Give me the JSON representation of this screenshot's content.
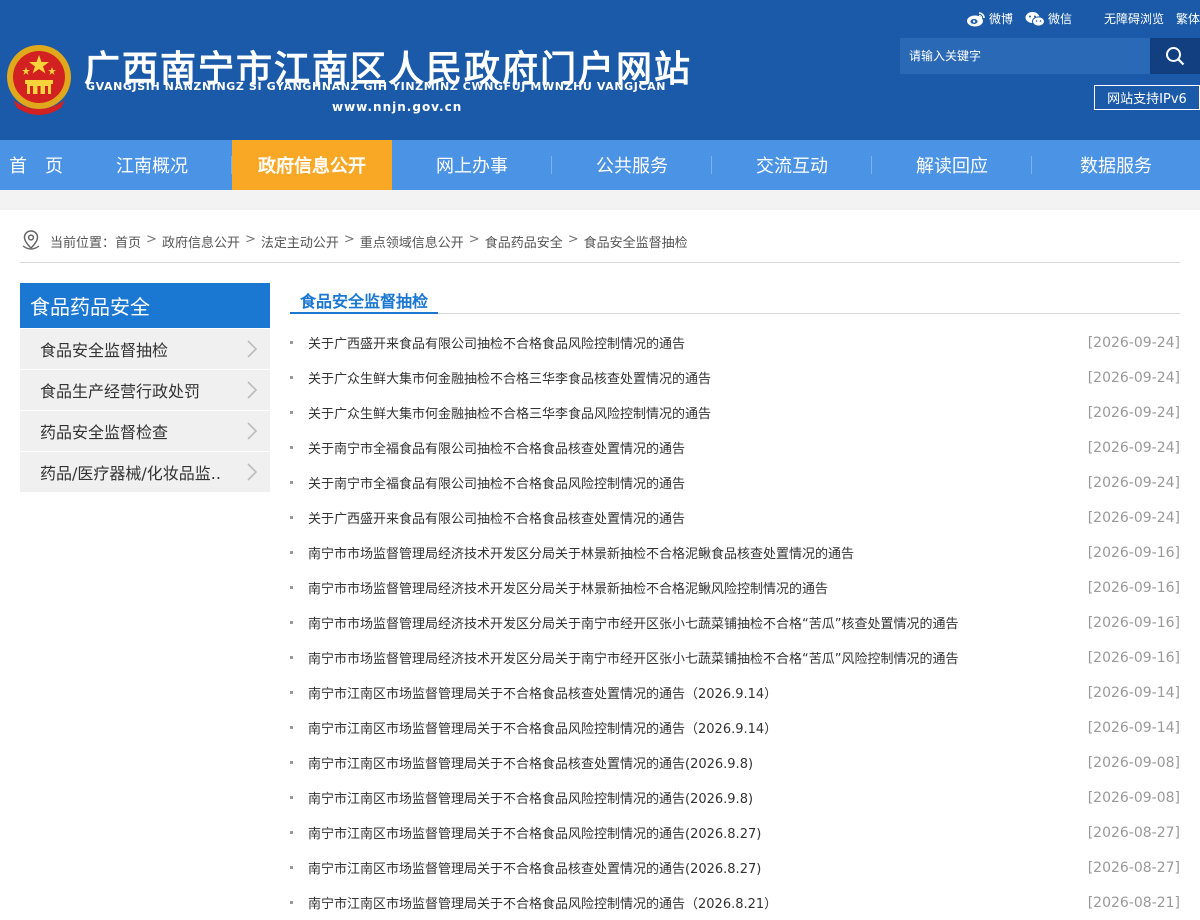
{
  "header": {
    "title": "广西南宁市江南区人民政府门户网站",
    "pinyin": "GVANGJSIH NANZNINGZ SI GYANGHNANZ GIH YINZMINZ CWNGFUJ MWNZHU VANGJCAN",
    "domain": "www.nnjn.gov.cn",
    "links": {
      "weibo": "微博",
      "wechat": "微信",
      "accessible": "无障碍浏览",
      "traditional": "繁体"
    },
    "search": {
      "placeholder": "请输入关键字"
    },
    "ipv6": "网站支持IPv6"
  },
  "nav": {
    "items": [
      {
        "label": "首　页"
      },
      {
        "label": "江南概况"
      },
      {
        "label": "政府信息公开"
      },
      {
        "label": "网上办事"
      },
      {
        "label": "公共服务"
      },
      {
        "label": "交流互动"
      },
      {
        "label": "解读回应"
      },
      {
        "label": "数据服务"
      }
    ]
  },
  "breadcrumb": {
    "prefix": "当前位置：",
    "items": [
      "首页",
      "政府信息公开",
      "法定主动公开",
      "重点领域信息公开",
      "食品药品安全",
      "食品安全监督抽检"
    ],
    "separator": ">"
  },
  "sidebar": {
    "title": "食品药品安全",
    "items": [
      {
        "label": "食品安全监督抽检"
      },
      {
        "label": "食品生产经营行政处罚"
      },
      {
        "label": "药品安全监督检查"
      },
      {
        "label": "药品/医疗器械/化妆品监.."
      }
    ]
  },
  "content": {
    "title": "食品安全监督抽检",
    "items": [
      {
        "title": "关于广西盛开来食品有限公司抽检不合格食品风险控制情况的通告",
        "date": "[2026-09-24]"
      },
      {
        "title": "关于广众生鲜大集市何金融抽检不合格三华李食品核查处置情况的通告",
        "date": "[2026-09-24]"
      },
      {
        "title": "关于广众生鲜大集市何金融抽检不合格三华李食品风险控制情况的通告",
        "date": "[2026-09-24]"
      },
      {
        "title": "关于南宁市全福食品有限公司抽检不合格食品核查处置情况的通告",
        "date": "[2026-09-24]"
      },
      {
        "title": "关于南宁市全福食品有限公司抽检不合格食品风险控制情况的通告",
        "date": "[2026-09-24]"
      },
      {
        "title": "关于广西盛开来食品有限公司抽检不合格食品核查处置情况的通告",
        "date": "[2026-09-24]"
      },
      {
        "title": "南宁市市场监督管理局经济技术开发区分局关于林景新抽检不合格泥鳅食品核查处置情况的通告",
        "date": "[2026-09-16]"
      },
      {
        "title": "南宁市市场监督管理局经济技术开发区分局关于林景新抽检不合格泥鳅风险控制情况的通告",
        "date": "[2026-09-16]"
      },
      {
        "title": "南宁市市场监督管理局经济技术开发区分局关于南宁市经开区张小七蔬菜铺抽检不合格“苦瓜”核查处置情况的通告",
        "date": "[2026-09-16]"
      },
      {
        "title": "南宁市市场监督管理局经济技术开发区分局关于南宁市经开区张小七蔬菜铺抽检不合格“苦瓜”风险控制情况的通告",
        "date": "[2026-09-16]"
      },
      {
        "title": "南宁市江南区市场监督管理局关于不合格食品核查处置情况的通告（2026.9.14）",
        "date": "[2026-09-14]"
      },
      {
        "title": "南宁市江南区市场监督管理局关于不合格食品风险控制情况的通告（2026.9.14）",
        "date": "[2026-09-14]"
      },
      {
        "title": "南宁市江南区市场监督管理局关于不合格食品核查处置情况的通告(2026.9.8)",
        "date": "[2026-09-08]"
      },
      {
        "title": "南宁市江南区市场监督管理局关于不合格食品风险控制情况的通告(2026.9.8)",
        "date": "[2026-09-08]"
      },
      {
        "title": "南宁市江南区市场监督管理局关于不合格食品风险控制情况的通告(2026.8.27)",
        "date": "[2026-08-27]"
      },
      {
        "title": "南宁市江南区市场监督管理局关于不合格食品核查处置情况的通告(2026.8.27)",
        "date": "[2026-08-27]"
      },
      {
        "title": "南宁市江南区市场监督管理局关于不合格食品风险控制情况的通告（2026.8.21）",
        "date": "[2026-08-21]"
      }
    ]
  },
  "colors": {
    "header_bg": "#1a5aa8",
    "nav_bg": "#4b93e5",
    "nav_active": "#f9a825",
    "sidebar_head": "#1a77d2",
    "accent": "#1a77d2",
    "date": "#999999"
  },
  "icons": {
    "emblem": "national-emblem",
    "weibo": "weibo-icon",
    "wechat": "wechat-icon",
    "search": "search-icon",
    "location": "location-pin-icon",
    "chevron": "chevron-right-icon"
  }
}
